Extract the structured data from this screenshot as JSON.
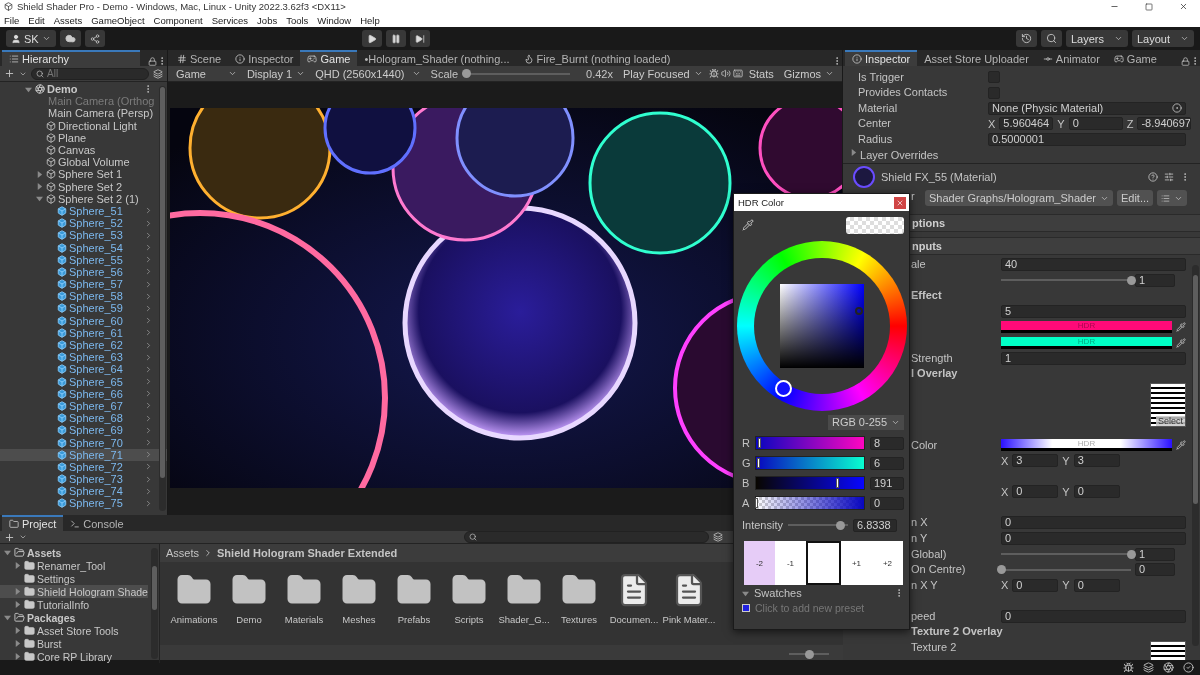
{
  "window": {
    "title": "Shield Shader Pro - Demo - Windows, Mac, Linux - Unity 2022.3.62f3 <DX11>"
  },
  "menu": [
    "File",
    "Edit",
    "Assets",
    "GameObject",
    "Component",
    "Services",
    "Jobs",
    "Tools",
    "Window",
    "Help"
  ],
  "toolbar": {
    "account": "SK",
    "layers": "Layers",
    "layout": "Layout"
  },
  "hierarchy": {
    "tab": "Hierarchy",
    "search_placeholder": "All",
    "tree": [
      {
        "label": "Demo",
        "kind": "scene",
        "selected": false,
        "expanded": true,
        "children": [
          {
            "label": "Main Camera (Orthog",
            "kind": "gameobject",
            "selected": false,
            "disabled": true
          },
          {
            "label": "Main Camera (Persp)",
            "kind": "gameobject",
            "selected": false,
            "disabled": false
          },
          {
            "label": "Directional Light",
            "kind": "gameobject",
            "selected": false,
            "disabled": false
          },
          {
            "label": "Plane",
            "kind": "gameobject",
            "selected": false,
            "disabled": false
          },
          {
            "label": "Canvas",
            "kind": "gameobject",
            "selected": false,
            "disabled": false
          },
          {
            "label": "Global Volume",
            "kind": "gameobject",
            "selected": false,
            "disabled": false
          },
          {
            "label": "Sphere Set 1",
            "kind": "gameobject",
            "selected": false,
            "disabled": false,
            "expanded": false
          },
          {
            "label": "Sphere Set 2",
            "kind": "gameobject",
            "selected": false,
            "disabled": false,
            "expanded": false
          },
          {
            "label": "Sphere Set 2 (1)",
            "kind": "gameobject",
            "selected": false,
            "disabled": false,
            "expanded": true,
            "children": [
              {
                "label": "Sphere_51",
                "kind": "prefab",
                "selected": false
              },
              {
                "label": "Sphere_52",
                "kind": "prefab",
                "selected": false
              },
              {
                "label": "Sphere_53",
                "kind": "prefab",
                "selected": false
              },
              {
                "label": "Sphere_54",
                "kind": "prefab",
                "selected": false
              },
              {
                "label": "Sphere_55",
                "kind": "prefab",
                "selected": false
              },
              {
                "label": "Sphere_56",
                "kind": "prefab",
                "selected": false
              },
              {
                "label": "Sphere_57",
                "kind": "prefab",
                "selected": false
              },
              {
                "label": "Sphere_58",
                "kind": "prefab",
                "selected": false
              },
              {
                "label": "Sphere_59",
                "kind": "prefab",
                "selected": false
              },
              {
                "label": "Sphere_60",
                "kind": "prefab",
                "selected": false
              },
              {
                "label": "Sphere_61",
                "kind": "prefab",
                "selected": false
              },
              {
                "label": "Sphere_62",
                "kind": "prefab",
                "selected": false
              },
              {
                "label": "Sphere_63",
                "kind": "prefab",
                "selected": false
              },
              {
                "label": "Sphere_64",
                "kind": "prefab",
                "selected": false
              },
              {
                "label": "Sphere_65",
                "kind": "prefab",
                "selected": false
              },
              {
                "label": "Sphere_66",
                "kind": "prefab",
                "selected": false
              },
              {
                "label": "Sphere_67",
                "kind": "prefab",
                "selected": false
              },
              {
                "label": "Sphere_68",
                "kind": "prefab",
                "selected": false
              },
              {
                "label": "Sphere_69",
                "kind": "prefab",
                "selected": false
              },
              {
                "label": "Sphere_70",
                "kind": "prefab",
                "selected": false
              },
              {
                "label": "Sphere_71",
                "kind": "prefab",
                "selected": true
              },
              {
                "label": "Sphere_72",
                "kind": "prefab",
                "selected": false
              },
              {
                "label": "Sphere_73",
                "kind": "prefab",
                "selected": false
              },
              {
                "label": "Sphere_74",
                "kind": "prefab",
                "selected": false
              },
              {
                "label": "Sphere_75",
                "kind": "prefab",
                "selected": false
              }
            ]
          }
        ]
      }
    ]
  },
  "center": {
    "tabs": [
      {
        "label": "Scene",
        "kind": "scene",
        "selected": false
      },
      {
        "label": "Inspector",
        "kind": "inspector",
        "selected": false
      },
      {
        "label": "Game",
        "kind": "game",
        "selected": true
      },
      {
        "label": "•Hologram_Shader (nothing...",
        "kind": "plain",
        "selected": false
      },
      {
        "label": "Fire_Burnt (nothing loaded)",
        "kind": "shader",
        "selected": false
      }
    ],
    "game_toolbar": {
      "view": "Game",
      "display": "Display 1",
      "resolution": "QHD (2560x1440)",
      "scale_label": "Scale",
      "scale": {
        "level": 0
      },
      "scale_value": "0.42x",
      "play_mode": "Play Focused",
      "stats": "Stats",
      "gizmos": "Gizmos"
    }
  },
  "inspector": {
    "tabs": [
      {
        "label": "Inspector",
        "kind": "inspector",
        "selected": true
      },
      {
        "label": "Asset Store Uploader",
        "kind": "plain",
        "selected": false
      },
      {
        "label": "Animator",
        "kind": "animator",
        "selected": false
      },
      {
        "label": "Game",
        "kind": "game",
        "selected": false
      }
    ],
    "collider": [
      {
        "kind": "checkbox",
        "label": "Is Trigger",
        "checked": false
      },
      {
        "kind": "checkbox",
        "label": "Provides Contacts",
        "checked": false
      },
      {
        "kind": "object",
        "label": "Material",
        "value": "None (Physic Material)"
      },
      {
        "kind": "vector",
        "label": "Center",
        "fields": [
          {
            "axis": "X",
            "value": "5.960464"
          },
          {
            "axis": "Y",
            "value": "0"
          },
          {
            "axis": "Z",
            "value": "-8.940697"
          }
        ]
      },
      {
        "kind": "float",
        "label": "Radius",
        "value": "0.5000001"
      },
      {
        "kind": "foldout",
        "label": "Layer Overrides",
        "expanded": false
      }
    ],
    "material": {
      "name": "Shield FX_55 (Material)",
      "shader_label": "r",
      "shader": "Shader Graphs/Hologram_Shader",
      "edit": "Edit...",
      "properties": [
        {
          "kind": "section",
          "label": "ptions"
        },
        {
          "kind": "section",
          "label": "nputs"
        },
        {
          "kind": "float",
          "label": "ale",
          "value": "40"
        },
        {
          "kind": "slider",
          "level": 1,
          "value": "1"
        },
        {
          "kind": "header",
          "label": "Effect"
        },
        {
          "kind": "float",
          "value": "5"
        },
        {
          "kind": "color",
          "color": "#ff0a78",
          "text": "HDR"
        },
        {
          "kind": "color",
          "color": "#00ffc6",
          "text": "HDR"
        },
        {
          "kind": "float",
          "label": "Strength",
          "value": "1"
        },
        {
          "kind": "header",
          "label": "l Overlay"
        },
        {
          "kind": "texture",
          "button": "Select"
        },
        {
          "kind": "gradient",
          "label": "Color",
          "text": "HDR"
        },
        {
          "kind": "vector",
          "fields": [
            {
              "axis": "X",
              "value": "3"
            },
            {
              "axis": "Y",
              "value": "3"
            }
          ]
        },
        {
          "kind": "vector",
          "fields": [
            {
              "axis": "X",
              "value": "0"
            },
            {
              "axis": "Y",
              "value": "0"
            }
          ]
        },
        {
          "kind": "float",
          "label": "n X",
          "value": "0"
        },
        {
          "kind": "float",
          "label": "n Y",
          "value": "0"
        },
        {
          "kind": "slider",
          "label": "Global)",
          "level": 1,
          "value": "1"
        },
        {
          "kind": "slider",
          "label": "On Centre)",
          "level": 0,
          "value": "0"
        },
        {
          "kind": "vector",
          "label": "n X Y",
          "fields": [
            {
              "axis": "X",
              "value": "0"
            },
            {
              "axis": "Y",
              "value": "0"
            }
          ]
        },
        {
          "kind": "float",
          "label": "peed",
          "value": "0"
        },
        {
          "kind": "header",
          "label": "Texture 2 Overlay"
        },
        {
          "kind": "texture",
          "label": "Texture 2"
        }
      ]
    }
  },
  "color_picker": {
    "title": "HDR Color",
    "mode": "RGB 0-255",
    "channels": [
      {
        "name": "R",
        "value": "8",
        "level": 0.03
      },
      {
        "name": "G",
        "value": "6",
        "level": 0.02
      },
      {
        "name": "B",
        "value": "191",
        "level": 0.75
      },
      {
        "name": "A",
        "value": "0",
        "level": 0
      }
    ],
    "intensity": {
      "label": "Intensity",
      "level": 0.88,
      "value": "6.8338"
    },
    "exposure": [
      {
        "label": "-2",
        "color": "#e6ccf7",
        "selected": false
      },
      {
        "label": "-1",
        "color": "#ffffff",
        "selected": false
      },
      {
        "color": "#ffffff",
        "selected": true
      },
      {
        "label": "+1",
        "color": "#ffffff",
        "selected": false
      },
      {
        "label": "+2",
        "color": "#ffffff",
        "selected": false
      }
    ],
    "swatches": {
      "label": "Swatches",
      "expanded": true,
      "hint": "Click to add new preset"
    }
  },
  "project": {
    "tabs": [
      {
        "label": "Project",
        "kind": "project",
        "selected": true
      },
      {
        "label": "Console",
        "kind": "console",
        "selected": false
      }
    ],
    "tree": [
      {
        "label": "Assets",
        "selected": false,
        "expanded": true,
        "children": [
          {
            "label": "Renamer_Tool",
            "selected": false,
            "expanded": false
          },
          {
            "label": "Settings",
            "selected": false
          },
          {
            "label": "Shield Hologram Shade",
            "selected": true,
            "expanded": false
          },
          {
            "label": "TutorialInfo",
            "selected": false,
            "expanded": false
          }
        ]
      },
      {
        "label": "Packages",
        "selected": false,
        "expanded": true,
        "children": [
          {
            "label": "Asset Store Tools",
            "selected": false,
            "expanded": false
          },
          {
            "label": "Burst",
            "selected": false,
            "expanded": false
          },
          {
            "label": "Core RP Library",
            "selected": false,
            "expanded": false
          }
        ]
      }
    ],
    "breadcrumb": [
      "Assets",
      "Shield Hologram Shader Extended"
    ],
    "items": [
      {
        "label": "Animations",
        "kind": "folder"
      },
      {
        "label": "Demo",
        "kind": "folder"
      },
      {
        "label": "Materials",
        "kind": "folder"
      },
      {
        "label": "Meshes",
        "kind": "folder"
      },
      {
        "label": "Prefabs",
        "kind": "folder"
      },
      {
        "label": "Scripts",
        "kind": "folder"
      },
      {
        "label": "Shader_G...",
        "kind": "folder"
      },
      {
        "label": "Textures",
        "kind": "folder"
      },
      {
        "label": "Documen...",
        "kind": "document"
      },
      {
        "label": "Pink Mater...",
        "kind": "document"
      }
    ],
    "zoom": {
      "level": 0.5
    }
  }
}
